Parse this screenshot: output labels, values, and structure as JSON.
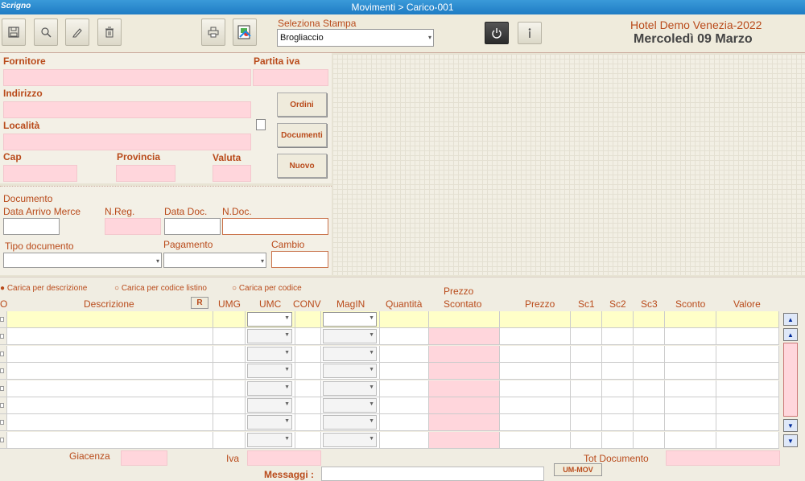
{
  "window": {
    "brand": "Scrigno",
    "title": "Movimenti > Carico-001"
  },
  "toolbar": {
    "save_icon": "floppy-icon",
    "search_icon": "magnifier-icon",
    "edit_icon": "pencil-icon",
    "delete_icon": "trash-icon",
    "print_icon": "printer-icon",
    "report_icon": "report-image-icon",
    "power_icon": "power-icon",
    "info_icon": "info-icon",
    "print_select_label": "Seleziona Stampa",
    "print_select_value": "Brogliaccio",
    "hotel": "Hotel Demo Venezia-2022",
    "date": "Mercoledì 09 Marzo"
  },
  "supplier": {
    "fornitore_label": "Fornitore",
    "piva_label": "Partita iva",
    "indirizzo_label": "Indirizzo",
    "localita_label": "Località",
    "cap_label": "Cap",
    "provincia_label": "Provincia",
    "valuta_label": "Valuta",
    "ordini_btn": "Ordini",
    "documenti_btn": "Documenti",
    "nuovo_btn": "Nuovo"
  },
  "document": {
    "section_label": "Documento",
    "data_arrivo_label": "Data Arrivo Merce",
    "nreg_label": "N.Reg.",
    "data_doc_label": "Data Doc.",
    "ndoc_label": "N.Doc.",
    "tipo_label": "Tipo documento",
    "pagamento_label": "Pagamento",
    "cambio_label": "Cambio"
  },
  "radios": [
    "Carica per descrizione",
    "Carica per codice listino",
    "Carica per codice"
  ],
  "table": {
    "headers": {
      "col_o": "O",
      "descrizione": "Descrizione",
      "r_btn": "R",
      "umg": "UMG",
      "umc": "UMC",
      "conv": "CONV",
      "magin": "MagIN",
      "quantita": "Quantità",
      "prezzo_scontato_top": "Prezzo",
      "prezzo_scontato_bottom": "Scontato",
      "prezzo": "Prezzo",
      "sc1": "Sc1",
      "sc2": "Sc2",
      "sc3": "Sc3",
      "sconto": "Sconto",
      "valore": "Valore"
    },
    "row_count": 8
  },
  "footer": {
    "giacenza_label": "Giacenza",
    "iva_label": "Iva",
    "tot_label": "Tot Documento",
    "ummov_btn": "UM-MOV",
    "messaggi_label": "Messaggi :"
  },
  "colors": {
    "label": "#b94a1a",
    "pink_field": "#ffd6dc",
    "titlebar": "#1f7cc4",
    "highlight_row": "#ffffc8"
  }
}
